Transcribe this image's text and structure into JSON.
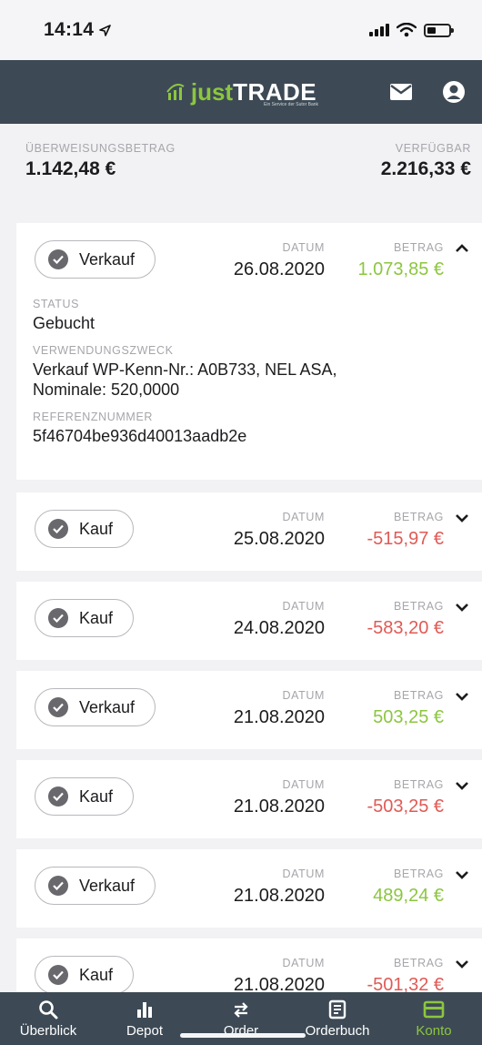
{
  "status_bar": {
    "time": "14:14"
  },
  "header": {
    "brand_prefix": "just",
    "brand_suffix": "TRADE",
    "brand_tagline": "Ein Service der Sutor Bank"
  },
  "balance": {
    "transfer_label": "ÜBERWEISUNGSBETRAG",
    "transfer_value": "1.142,48 €",
    "available_label": "VERFÜGBAR",
    "available_value": "2.216,33 €"
  },
  "columns": {
    "date_label": "DATUM",
    "amount_label": "BETRAG"
  },
  "details_labels": {
    "status": "STATUS",
    "purpose": "VERWENDUNGSZWECK",
    "reference": "REFERENZNUMMER"
  },
  "transactions": [
    {
      "type": "Verkauf",
      "date": "26.08.2020",
      "amount": "1.073,85 €",
      "sign": "positive",
      "expanded": true,
      "status": "Gebucht",
      "purpose_line1": "Verkauf WP-Kenn-Nr.: A0B733, NEL ASA,",
      "purpose_line2": "Nominale:  520,0000",
      "reference": "5f46704be936d40013aadb2e"
    },
    {
      "type": "Kauf",
      "date": "25.08.2020",
      "amount": "-515,97 €",
      "sign": "negative"
    },
    {
      "type": "Kauf",
      "date": "24.08.2020",
      "amount": "-583,20 €",
      "sign": "negative"
    },
    {
      "type": "Verkauf",
      "date": "21.08.2020",
      "amount": "503,25 €",
      "sign": "positive"
    },
    {
      "type": "Kauf",
      "date": "21.08.2020",
      "amount": "-503,25 €",
      "sign": "negative"
    },
    {
      "type": "Verkauf",
      "date": "21.08.2020",
      "amount": "489,24 €",
      "sign": "positive"
    },
    {
      "type": "Kauf",
      "date": "21.08.2020",
      "amount": "-501,32 €",
      "sign": "negative"
    }
  ],
  "nav": [
    {
      "label": "Überblick",
      "icon": "search-icon"
    },
    {
      "label": "Depot",
      "icon": "bar-chart-icon"
    },
    {
      "label": "Order",
      "icon": "swap-icon"
    },
    {
      "label": "Orderbuch",
      "icon": "document-icon"
    },
    {
      "label": "Konto",
      "icon": "card-icon",
      "active": true
    }
  ],
  "colors": {
    "header_bg": "#3d4a55",
    "accent_green": "#8cc63f",
    "negative_red": "#e05a55"
  }
}
